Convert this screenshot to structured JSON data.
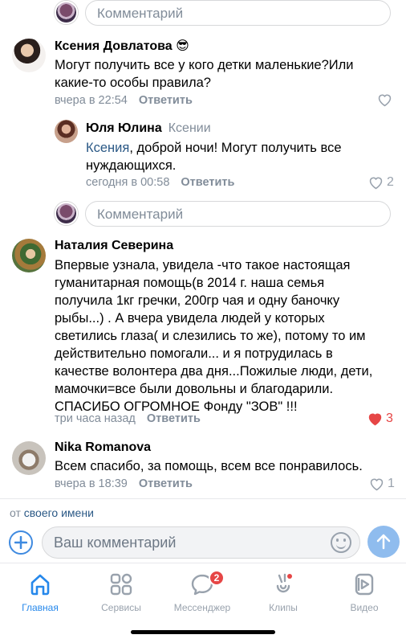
{
  "comment_input_placeholder": "Комментарий",
  "comments": [
    {
      "author": "Ксения Довлатова",
      "emoji": "😎",
      "text_lines": [
        "Могут получить все у кого детки маленькие?Или",
        "какие-то особы правила?"
      ],
      "time": "вчера в 22:54",
      "reply_label": "Ответить",
      "likes": ""
    },
    {
      "author": "Юля Юлина",
      "reply_to": "Ксении",
      "mention": "Ксения",
      "text_first_rest": ", доброй ночи! Могут получить все",
      "text_line2": "нуждающихся.",
      "time": "сегодня в 00:58",
      "reply_label": "Ответить",
      "likes": "2"
    },
    {
      "author": "Наталия Северина",
      "text_lines": [
        "Впервые узнала, увидела -что такое настоящая",
        "гуманитарная помощь(в 2014 г. наша семья",
        "получила 1кг гречки, 200гр чая и одну баночку",
        "рыбы...) . А вчера увидела людей у которых",
        "светились глаза( и слезились то же), потому то им",
        "действительно помогали... и я потрудилась в",
        "качестве волонтера два дня...Пожилые люди, дети,",
        "мамочки=все были довольны и благодарили.",
        "СПАСИБО ОГРОМНОЕ Фонду \"ЗОВ\" !!!"
      ],
      "time": "три часа назад",
      "reply_label": "Ответить",
      "likes": "3"
    },
    {
      "author": "Nika Romanova",
      "text_lines": [
        "Всем спасибо, за помощь, всем все понравилось."
      ],
      "time": "вчера в 18:39",
      "reply_label": "Ответить",
      "likes": "1"
    }
  ],
  "composer": {
    "from_prefix": "от",
    "from_link": "своего имени",
    "placeholder": "Ваш комментарий"
  },
  "tabbar": {
    "items": [
      {
        "label": "Главная",
        "icon": "home-icon",
        "active": true
      },
      {
        "label": "Сервисы",
        "icon": "services-icon",
        "active": false
      },
      {
        "label": "Мессенджер",
        "icon": "messenger-icon",
        "active": false
      },
      {
        "label": "Клипы",
        "icon": "clips-icon",
        "active": false
      },
      {
        "label": "Видео",
        "icon": "video-icon",
        "active": false
      }
    ],
    "messenger_badge": "2"
  },
  "colors": {
    "accent": "#2688eb",
    "link": "#2a5885",
    "like_red": "#e64646",
    "secondary_text": "#818c99"
  }
}
